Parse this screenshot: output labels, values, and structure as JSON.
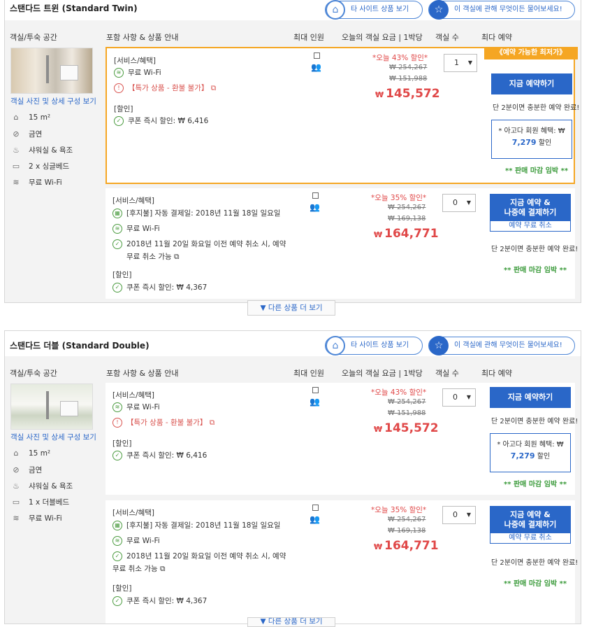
{
  "rooms": [
    {
      "title": "스탠다드 트윈 (Standard Twin)",
      "other_sites": "타 사이트 상품 보기",
      "ask": "이 객실에 관해 무엇이든 물어보세요!",
      "headers": [
        "객실/투숙 공간",
        "포함 사항 & 상품 안내",
        "최대 인원",
        "오늘의 객실 요금 | 1박당",
        "객실 수",
        "최다 예약"
      ],
      "photo_link": "객실 사진 및 상세 구성 보기",
      "amenities": [
        "15 m²",
        "금연",
        "샤워실 & 욕조",
        "2 x 싱글베드",
        "무료 Wi-Fi"
      ],
      "offers": [
        {
          "services_label": "[서비스/혜택]",
          "wifi": "무료 Wi-Fi",
          "special": "【특가 상품 - 환불 불가】",
          "discount_label": "[할인]",
          "coupon": "쿠폰 즉시 할인: ₩ 6,416",
          "sale": "*오늘 43% 할인*",
          "orig1": "₩ 254,267",
          "orig2": "₩ 151,988",
          "currency": "₩",
          "price": "145,572",
          "qty": "1",
          "lowest": "《예약 가능한 최저가》",
          "book": "지금 예약하기",
          "note": "단 2분이면 충분한 예약 완료!",
          "member_line": "* 아고다 회원 혜택: ₩",
          "member_amount": "7,279",
          "member_suffix": "할인",
          "soon": "** 판매 마감 임박 **"
        },
        {
          "services_label": "[서비스/혜택]",
          "auto_pay": "[후지불] 자동 결제일: 2018년 11월 18일 일요일",
          "wifi": "무료 Wi-Fi",
          "cancel_1": "2018년 11월 20일 화요일 이전 예약 취소 시, 예약",
          "cancel_2": "무료 취소 가능",
          "discount_label": "[할인]",
          "coupon": "쿠폰 즉시 할인: ₩ 4,367",
          "sale": "*오늘 35% 할인*",
          "orig1": "₩ 254,267",
          "orig2": "₩ 169,138",
          "currency": "₩",
          "price": "164,771",
          "qty": "0",
          "book_line1": "지금 예약 &",
          "book_line2": "나중에 결제하기",
          "free_cancel": "예약 무료 취소",
          "note": "단 2분이면 충분한 예약 완료!",
          "soon": "** 판매 마감 임박 **"
        }
      ],
      "more": "▼ 다른 상품 더 보기"
    },
    {
      "title": "스탠다드 더블 (Standard Double)",
      "other_sites": "타 사이트 상품 보기",
      "ask": "이 객실에 관해 무엇이든 물어보세요!",
      "headers": [
        "객실/투숙 공간",
        "포함 사항 & 상품 안내",
        "최대 인원",
        "오늘의 객실 요금 | 1박당",
        "객실 수",
        "최다 예약"
      ],
      "photo_link": "객실 사진 및 상세 구성 보기",
      "amenities": [
        "15 m²",
        "금연",
        "샤워실 & 욕조",
        "1 x 더블베드",
        "무료 Wi-Fi"
      ],
      "offers": [
        {
          "services_label": "[서비스/혜택]",
          "wifi": "무료 Wi-Fi",
          "special": "【특가 상품 - 환불 불가】",
          "discount_label": "[할인]",
          "coupon": "쿠폰 즉시 할인: ₩ 6,416",
          "sale": "*오늘 43% 할인*",
          "orig1": "₩ 254,267",
          "orig2": "₩ 151,988",
          "currency": "₩",
          "price": "145,572",
          "qty": "0",
          "book": "지금 예약하기",
          "note": "단 2분이면 충분한 예약 완료!",
          "member_line": "* 아고다 회원 혜택: ₩",
          "member_amount": "7,279",
          "member_suffix": "할인",
          "soon": "** 판매 마감 임박 **"
        },
        {
          "services_label": "[서비스/혜택]",
          "auto_pay": "[후지불] 자동 결제일: 2018년 11월 18일 일요일",
          "wifi": "무료 Wi-Fi",
          "cancel_1": "2018년 11월 20일 화요일 이전 예약 취소 시, 예약",
          "cancel_2": "무료 취소 가능",
          "discount_label": "[할인]",
          "coupon": "쿠폰 즉시 할인: ₩ 4,367",
          "sale": "*오늘 35% 할인*",
          "orig1": "₩ 254,267",
          "orig2": "₩ 169,138",
          "currency": "₩",
          "price": "164,771",
          "qty": "0",
          "book_line1": "지금 예약 &",
          "book_line2": "나중에 결제하기",
          "free_cancel": "예약 무료 취소",
          "note": "단 2분이면 충분한 예약 완료!",
          "soon": "** 판매 마감 임박 **"
        }
      ],
      "more": "▼ 다른 상품 더 보기"
    }
  ],
  "colors": {
    "accent": "#2a67c8",
    "price": "#e04848",
    "highlight": "#f5a623",
    "soon": "#3a9a3a"
  }
}
